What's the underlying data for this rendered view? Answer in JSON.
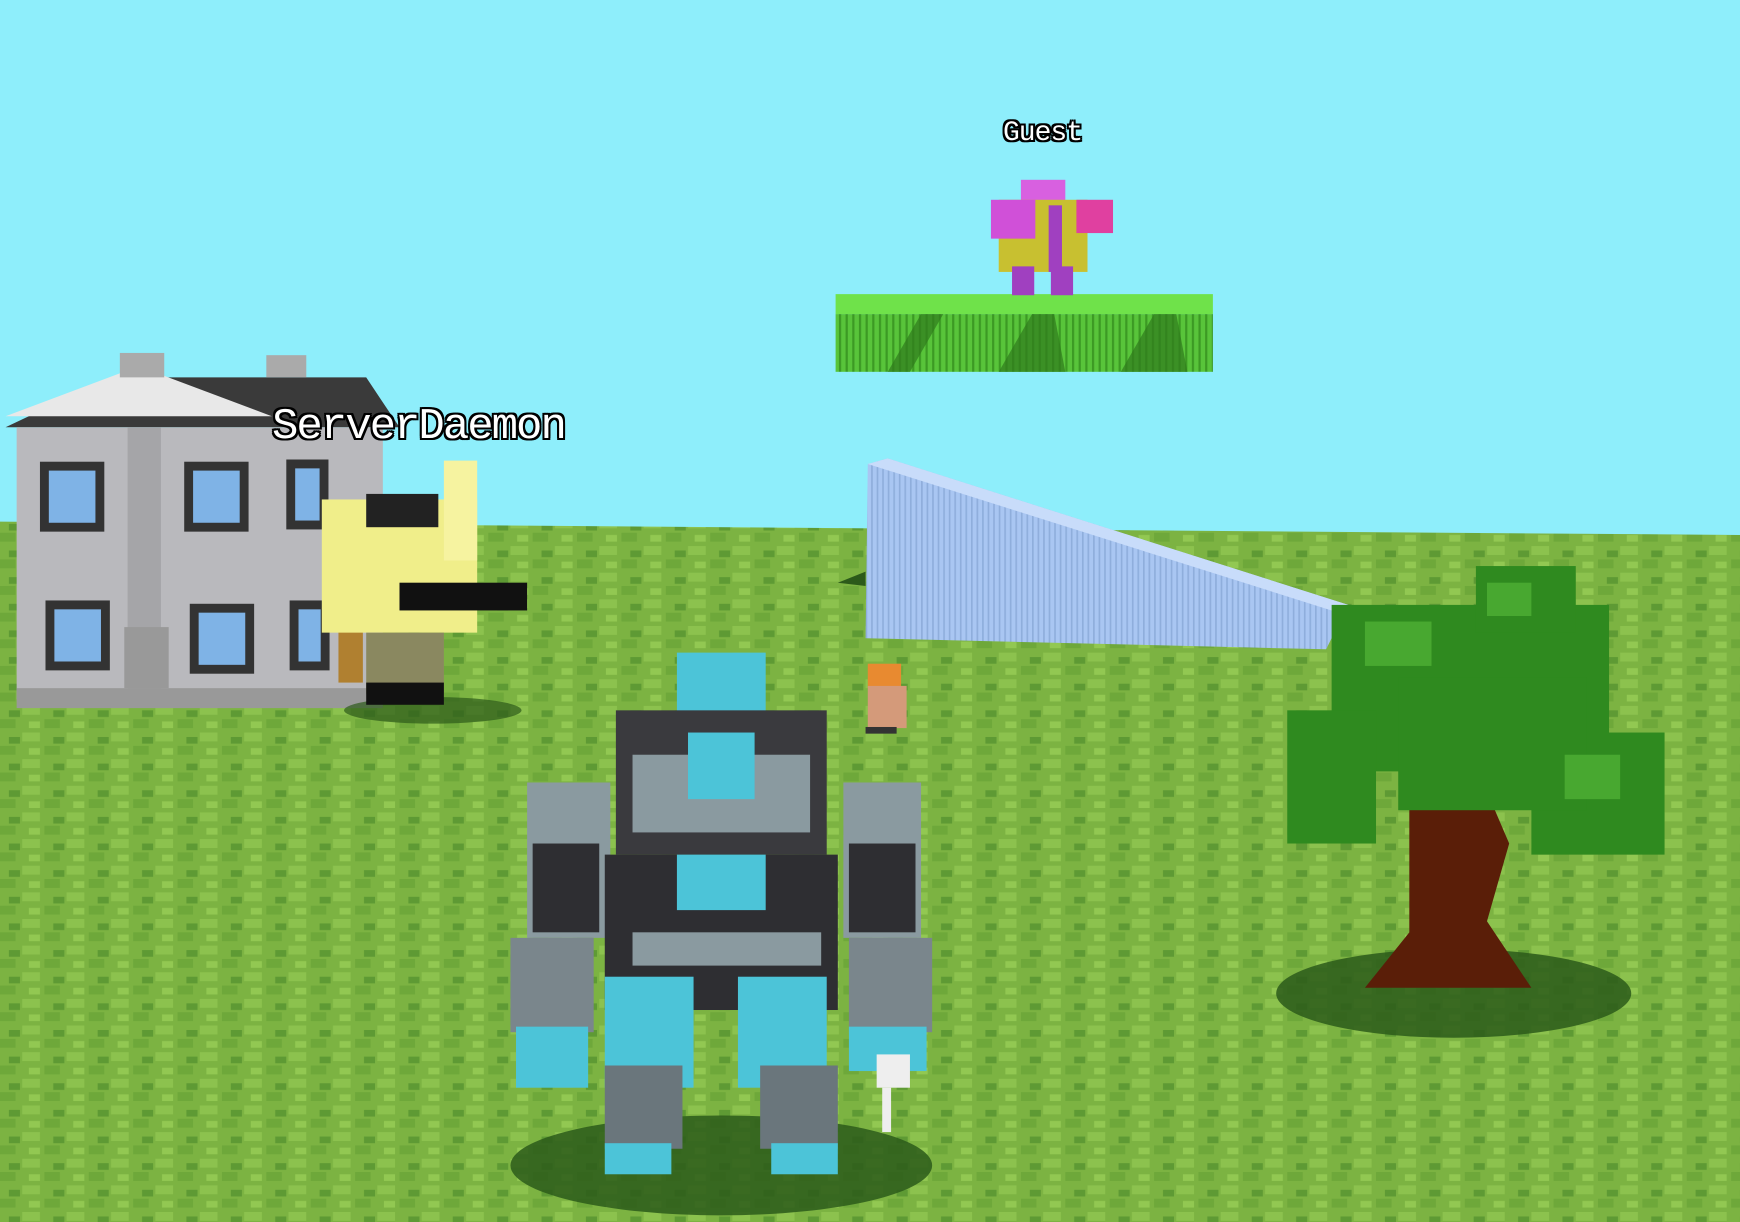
{
  "players": [
    {
      "name": "ServerDaemon"
    },
    {
      "name": "Guest"
    }
  ],
  "colors": {
    "sky": "#8eeefb",
    "ground": "#7cb342",
    "platform": "#6fe24a",
    "ramp": "#a9c6f2",
    "foliage": "#2f8a1f",
    "trunk": "#5a1e08",
    "player_accent": "#4cc4d8"
  }
}
